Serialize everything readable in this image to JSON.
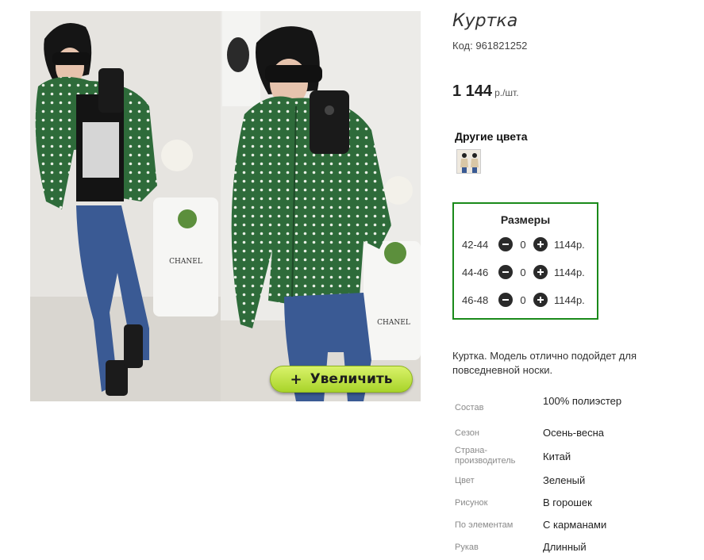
{
  "product": {
    "title": "Куртка",
    "code_label": "Код:",
    "code_value": "961821252",
    "price": "1 144",
    "price_unit": "р./шт."
  },
  "photo": {
    "zoom_label": "Увеличить",
    "zoom_icon": "plus-icon"
  },
  "other_colors": {
    "title": "Другие цвета"
  },
  "sizes": {
    "title": "Размеры",
    "rows": [
      {
        "label": "42-44",
        "qty": "0",
        "price": "1144р."
      },
      {
        "label": "44-46",
        "qty": "0",
        "price": "1144р."
      },
      {
        "label": "46-48",
        "qty": "0",
        "price": "1144р."
      }
    ]
  },
  "description": "Куртка. Модель отлично подойдет для повседневной носки.",
  "properties": [
    {
      "key": "Состав",
      "value": "100% полиэстер"
    },
    {
      "key": "Сезон",
      "value": "Осень-весна"
    },
    {
      "key": "Страна-производитель",
      "value": "Китай"
    },
    {
      "key": "Цвет",
      "value": "Зеленый"
    },
    {
      "key": "Рисунок",
      "value": "В горошек"
    },
    {
      "key": "По элементам",
      "value": "С карманами"
    },
    {
      "key": "Рукав",
      "value": "Длинный"
    }
  ],
  "colors": {
    "border_accent": "#1a8a1a",
    "zoom_button": "#bfe34a",
    "jacket": "#2e6b3a"
  }
}
